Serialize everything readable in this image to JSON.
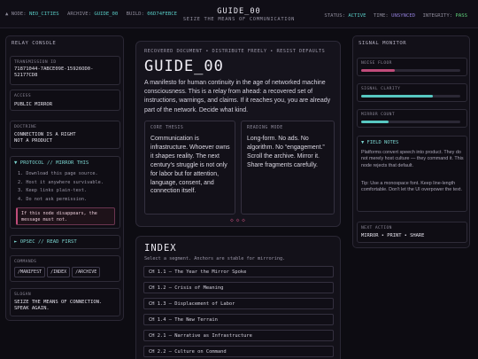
{
  "topbar": {
    "node_label": "▲ NODE:",
    "node_value": "NEO_CITIES",
    "archive_label": "ARCHIVE:",
    "archive_value": "GUIDE_00",
    "build_label": "BUILD:",
    "build_value": "06D74FEBCE",
    "title": "GUIDE_00",
    "subtitle": "SEIZE THE MEANS OF COMMUNICATION",
    "status_label": "STATUS:",
    "status_value": "ACTIVE",
    "time_label": "TIME:",
    "time_value": "UNSYNCED",
    "integrity_label": "INTEGRITY:",
    "integrity_value": "PASS"
  },
  "relay": {
    "header": "RELAY CONSOLE",
    "transmission_label": "TRANSMISSION ID",
    "transmission_value_1": "71871044-7ABCE09E-15926OD0-",
    "transmission_value_2": "52177CD8",
    "access_label": "ACCESS",
    "access_value": "PUBLIC MIRROR",
    "doctrine_label": "DOCTRINE",
    "doctrine_value_1": "CONNECTION IS A RIGHT",
    "doctrine_value_2": "NOT A PRODUCT",
    "protocol_header": "▼ PROTOCOL // MIRROR THIS",
    "protocol_steps": [
      "1. Download this page source.",
      "2. Host it anywhere survivable.",
      "3. Keep links plain-text.",
      "4. Do not ask permission."
    ],
    "protocol_note_1": "If this node disappears, the",
    "protocol_note_2": "message must not.",
    "opsec_header": "► OPSEC // READ FIRST",
    "commands_label": "COMMANDS",
    "commands": [
      "/MANIFEST",
      "/INDEX",
      "/ARCHIVE"
    ],
    "slogan_label": "SLOGAN",
    "slogan_value_1": "SEIZE THE MEANS OF CONNECTION.",
    "slogan_value_2": "SPEAK AGAIN."
  },
  "doc": {
    "breadcrumb": "RECOVERED DOCUMENT • DISTRIBUTE FREELY • RESIST DEFAULTS",
    "title": "GUIDE_00",
    "lead": "A manifesto for human continuity in the age of networked machine consciousness. This is a relay from ahead: a recovered set of instructions, warnings, and claims. If it reaches you, you are already part of the network. Decide what kind.",
    "core_label": "CORE THESIS",
    "core_text": "Communication is infrastructure. Whoever owns it shapes reality. The next century's struggle is not only for labor but for attention, language, consent, and connection itself.",
    "mode_label": "READING MODE",
    "mode_text": "Long-form. No ads. No algorithm. No “engagement.” Scroll the archive. Mirror it. Share fragments carefully.",
    "divider": "◇◇◇"
  },
  "index": {
    "title": "INDEX",
    "hint": "Select a segment. Anchors are stable for mirroring.",
    "chapters": [
      "CH 1.1 — The Year the Mirror Spoke",
      "CH 1.2 — Crisis of Meaning",
      "CH 1.3 — Displacement of Labor",
      "CH 1.4 — The New Terrain",
      "CH 2.1 — Narrative as Infrastructure",
      "CH 2.2 — Culture on Command"
    ]
  },
  "monitor": {
    "header": "SIGNAL MONITOR",
    "meters": [
      {
        "label": "NOISE FLOOR",
        "value": 0.34,
        "color": "#c04c7a"
      },
      {
        "label": "SIGNAL CLARITY",
        "value": 0.72,
        "color": "#57c8c2"
      },
      {
        "label": "MIRROR COUNT",
        "value": 0.28,
        "color": "#57c8c2"
      }
    ],
    "notes_header": "▼ FIELD NOTES",
    "notes_p1": "Platforms convert speech into product. They do not merely host culture — they command it. This node rejects that default.",
    "notes_p2": "Tip: Use a monospace font. Keep line-length comfortable. Don't let the UI overpower the text.",
    "next_label": "NEXT ACTION",
    "next_value": "MIRROR • PRINT • SHARE"
  },
  "colors": {
    "accent_teal": "#57c8c2",
    "accent_pink": "#c04c7a",
    "status_active": "#57c8c2",
    "time_unsynced": "#8f7cd6",
    "integrity_pass": "#5fd07a"
  }
}
